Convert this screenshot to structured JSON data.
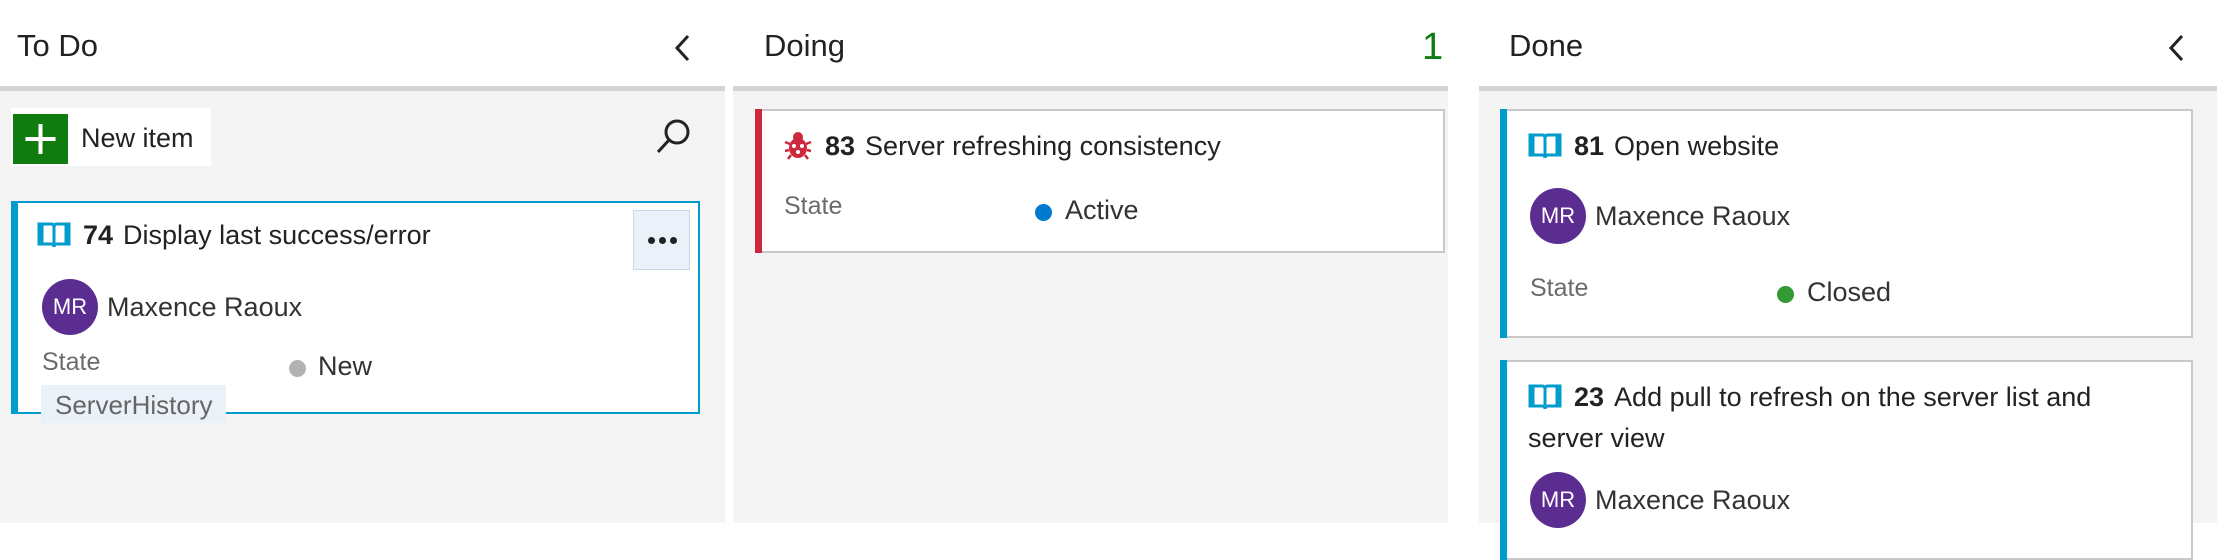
{
  "colors": {
    "accent_green": "#107c10",
    "story_stripe": "#009ccc",
    "bug_stripe": "#cc293d",
    "avatar": "#5c2d91",
    "state_new": "#b2b2b2",
    "state_active": "#007acc",
    "state_closed": "#339933"
  },
  "columns": [
    {
      "title": "To Do",
      "chevron_icon": "chevron-left-icon",
      "new_item_label": "New item",
      "add_icon": "plus-icon",
      "search_icon": "search-icon",
      "cards": [
        {
          "id": "74",
          "title": "Display last success/error",
          "type_icon": "user-story-book-icon",
          "assignee_initials": "MR",
          "assignee": "Maxence Raoux",
          "state_label": "State",
          "state": "New",
          "tag": "ServerHistory",
          "more_icon": "ellipsis-icon"
        }
      ]
    },
    {
      "title": "Doing",
      "count": "1",
      "cards": [
        {
          "id": "83",
          "title": "Server refreshing consistency",
          "type_icon": "bug-icon",
          "state_label": "State",
          "state": "Active"
        }
      ]
    },
    {
      "title": "Done",
      "chevron_icon": "chevron-left-icon",
      "cards": [
        {
          "id": "81",
          "title": "Open website",
          "type_icon": "user-story-book-icon",
          "assignee_initials": "MR",
          "assignee": "Maxence Raoux",
          "state_label": "State",
          "state": "Closed"
        },
        {
          "id": "23",
          "title": "Add pull to refresh on the server list and server view",
          "type_icon": "user-story-book-icon",
          "assignee_initials": "MR",
          "assignee": "Maxence Raoux"
        }
      ]
    }
  ]
}
